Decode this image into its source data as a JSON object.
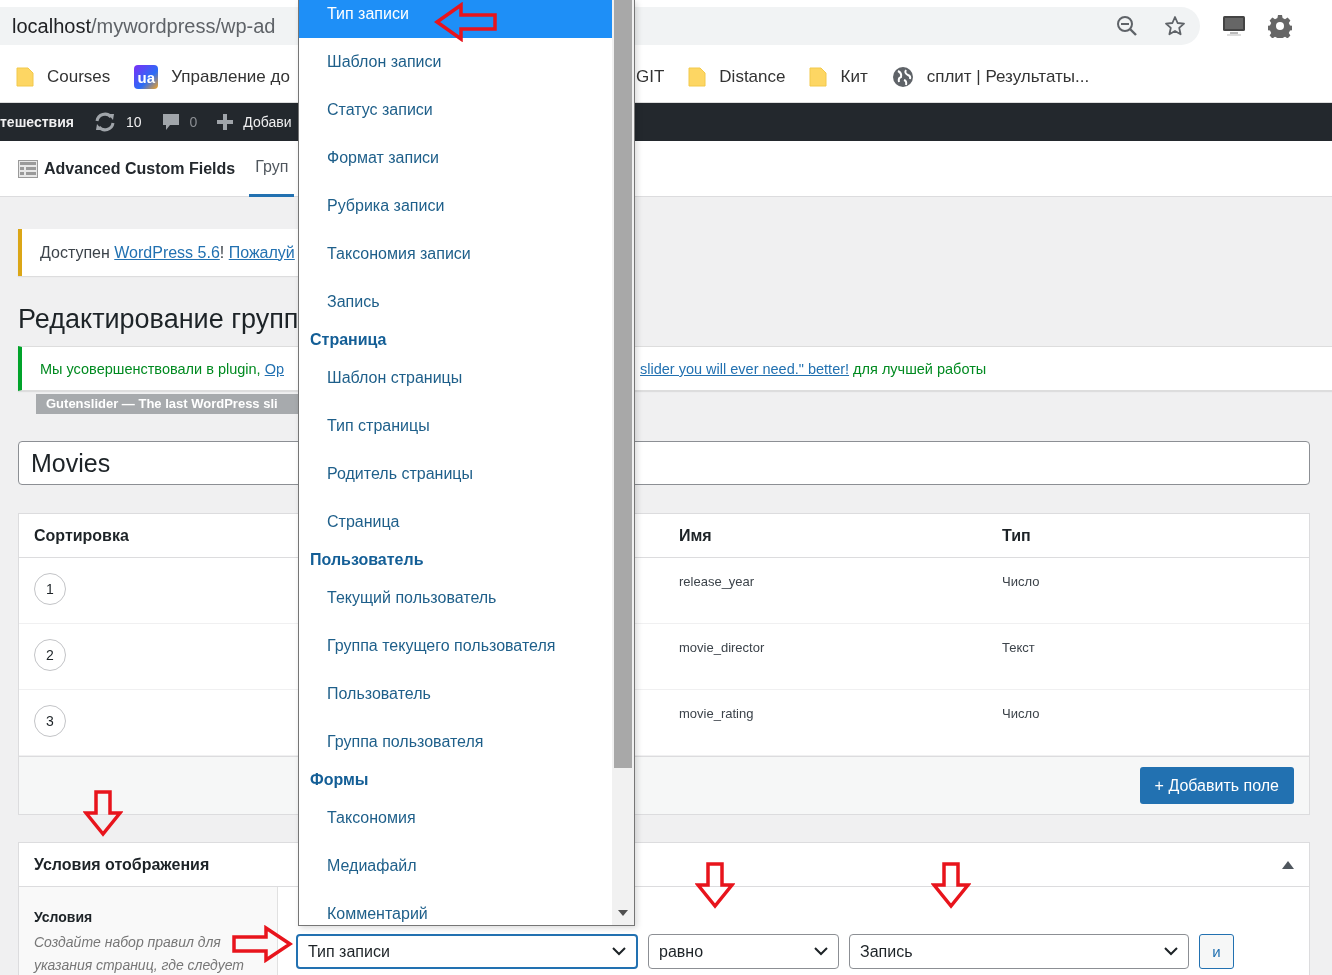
{
  "browser": {
    "url_host": "localhost",
    "url_path": "/mywordpress/wp-ad",
    "bookmarks_left": [
      {
        "kind": "folder",
        "label": "Courses"
      },
      {
        "kind": "app",
        "icon_text": "ua",
        "label": "Управление до"
      }
    ],
    "bookmarks_right": [
      {
        "kind": "plain",
        "label": "GIT"
      },
      {
        "kind": "folder",
        "label": "Distance"
      },
      {
        "kind": "folder",
        "label": "Кит"
      },
      {
        "kind": "globe",
        "label": "сплит | Результаты..."
      }
    ]
  },
  "admin_bar": [
    {
      "kind": "text",
      "label": "тешествия"
    },
    {
      "kind": "updates",
      "label": "10"
    },
    {
      "kind": "comments",
      "label": "0"
    },
    {
      "kind": "new",
      "label": "Добави"
    }
  ],
  "plugin_header": {
    "title": "Advanced Custom Fields",
    "tabs": [
      {
        "label": "Груп",
        "selected": true
      }
    ]
  },
  "update_notice": [
    {
      "kind": "text",
      "text": "Доступен "
    },
    {
      "kind": "link",
      "text": "WordPress 5.6"
    },
    {
      "kind": "text",
      "text": "! "
    },
    {
      "kind": "link",
      "text": "Пожалуй"
    }
  ],
  "page_title": "Редактирование групп",
  "plugin_notice": {
    "left": [
      {
        "kind": "text",
        "text": "Мы усовершенствовали в plugin, "
      },
      {
        "kind": "link",
        "text": "Op"
      }
    ],
    "right": [
      {
        "kind": "link",
        "text": "slider you will ever need.\" better!"
      },
      {
        "kind": "text",
        "text": " для лучшей работы"
      }
    ],
    "tag": "Gutenslider — The last WordPress sli"
  },
  "group_title": "Movies",
  "fields_table": {
    "columns": {
      "order": "Сортировка",
      "name": "Имя",
      "type": "Тип"
    },
    "rows": [
      {
        "order": "1",
        "name": "release_year",
        "type": "Число"
      },
      {
        "order": "2",
        "name": "movie_director",
        "type": "Текст"
      },
      {
        "order": "3",
        "name": "movie_rating",
        "type": "Число"
      }
    ],
    "add_button": "+ Добавить поле"
  },
  "location_box": {
    "title": "Условия отображения",
    "expanded": true,
    "label": "Условия",
    "description": "Создайте набор правил для указания страниц, где следует",
    "rule": [
      {
        "kind": "select",
        "value": "Тип записи",
        "focused": true
      },
      {
        "kind": "select",
        "value": "равно",
        "focused": false
      },
      {
        "kind": "select",
        "value": "Запись",
        "focused": false
      },
      {
        "kind": "button",
        "label": "и"
      }
    ]
  },
  "dropdown": [
    {
      "kind": "option",
      "label": "Тип записи",
      "selected": true
    },
    {
      "kind": "option",
      "label": "Шаблон записи",
      "selected": false
    },
    {
      "kind": "option",
      "label": "Статус записи",
      "selected": false
    },
    {
      "kind": "option",
      "label": "Формат записи",
      "selected": false
    },
    {
      "kind": "option",
      "label": "Рубрика записи",
      "selected": false
    },
    {
      "kind": "option",
      "label": "Таксономия записи",
      "selected": false
    },
    {
      "kind": "option",
      "label": "Запись",
      "selected": false
    },
    {
      "kind": "group",
      "label": "Страница"
    },
    {
      "kind": "option",
      "label": "Шаблон страницы",
      "selected": false
    },
    {
      "kind": "option",
      "label": "Тип страницы",
      "selected": false
    },
    {
      "kind": "option",
      "label": "Родитель страницы",
      "selected": false
    },
    {
      "kind": "option",
      "label": "Страница",
      "selected": false
    },
    {
      "kind": "group",
      "label": "Пользователь"
    },
    {
      "kind": "option",
      "label": "Текущий пользователь",
      "selected": false
    },
    {
      "kind": "option",
      "label": "Группа текущего пользователя",
      "selected": false
    },
    {
      "kind": "option",
      "label": "Пользователь",
      "selected": false
    },
    {
      "kind": "option",
      "label": "Группа пользователя",
      "selected": false
    },
    {
      "kind": "group",
      "label": "Формы"
    },
    {
      "kind": "option",
      "label": "Таксономия",
      "selected": false
    },
    {
      "kind": "option",
      "label": "Медиафайл",
      "selected": false
    },
    {
      "kind": "option",
      "label": "Комментарий",
      "selected": false
    }
  ]
}
